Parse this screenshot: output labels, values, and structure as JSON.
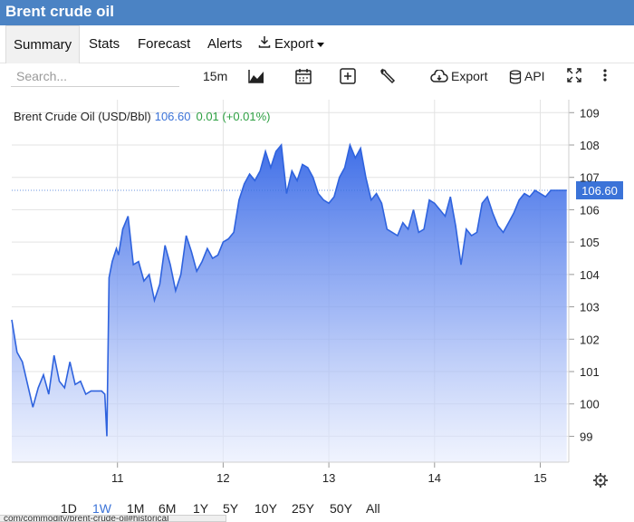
{
  "header": {
    "title": "Brent crude oil"
  },
  "tabs": [
    {
      "label": "Summary"
    },
    {
      "label": "Stats"
    },
    {
      "label": "Forecast"
    },
    {
      "label": "Alerts"
    },
    {
      "label": "Export"
    }
  ],
  "toolbar": {
    "search_placeholder": "Search...",
    "interval": "15m",
    "export_label": "Export",
    "api_label": "API"
  },
  "quote": {
    "name": "Brent Crude Oil (USD/Bbl)",
    "price": "106.60",
    "change": "0.01 (+0.01%)",
    "price_color": "#3b73d8",
    "change_color": "#2ea043"
  },
  "ranges": [
    "1D",
    "1W",
    "1M",
    "6M",
    "1Y",
    "5Y",
    "10Y",
    "25Y",
    "50Y",
    "All"
  ],
  "active_range": "1W",
  "status_url": "com/commodity/brent-crude-oil#historical",
  "colors": {
    "accent": "#3b73d8",
    "header": "#4b83c4"
  },
  "chart_data": {
    "type": "area",
    "title": "",
    "xlabel": "",
    "ylabel": "",
    "x_ticks": [
      "11",
      "12",
      "13",
      "14",
      "15"
    ],
    "ylim": [
      98.2,
      109.4
    ],
    "y_ticks": [
      99,
      100,
      101,
      102,
      103,
      104,
      105,
      106,
      107,
      108,
      109
    ],
    "last_value": 106.6,
    "last_value_label": "106.60",
    "grid": true,
    "series": [
      {
        "x": [
          10.0,
          10.05,
          10.1,
          10.15,
          10.2,
          10.25,
          10.3,
          10.35,
          10.4,
          10.45,
          10.5,
          10.55,
          10.6,
          10.65,
          10.7,
          10.75,
          10.8,
          10.85,
          10.88,
          10.9,
          10.92,
          10.95,
          10.99,
          11.01,
          11.05,
          11.1,
          11.15,
          11.2,
          11.25,
          11.3,
          11.35,
          11.4,
          11.45,
          11.5,
          11.55,
          11.6,
          11.65,
          11.7,
          11.75,
          11.8,
          11.85,
          11.9,
          11.95,
          12.0,
          12.05,
          12.1,
          12.15,
          12.2,
          12.25,
          12.3,
          12.35,
          12.4,
          12.45,
          12.5,
          12.55,
          12.6,
          12.65,
          12.7,
          12.75,
          12.8,
          12.85,
          12.9,
          12.95,
          13.0,
          13.05,
          13.1,
          13.15,
          13.2,
          13.25,
          13.3,
          13.35,
          13.4,
          13.45,
          13.5,
          13.55,
          13.6,
          13.65,
          13.7,
          13.75,
          13.8,
          13.85,
          13.9,
          13.95,
          14.0,
          14.05,
          14.1,
          14.15,
          14.2,
          14.25,
          14.3,
          14.35,
          14.4,
          14.45,
          14.5,
          14.55,
          14.6,
          14.65,
          14.7,
          14.75,
          14.8,
          14.85,
          14.9,
          14.95,
          15.0,
          15.05,
          15.1,
          15.15,
          15.2,
          15.25
        ],
        "values": [
          102.6,
          101.6,
          101.3,
          100.6,
          99.9,
          100.5,
          100.9,
          100.3,
          101.5,
          100.7,
          100.5,
          101.3,
          100.6,
          100.7,
          100.3,
          100.4,
          100.4,
          100.4,
          100.3,
          99.0,
          103.9,
          104.4,
          104.8,
          104.6,
          105.4,
          105.8,
          104.3,
          104.4,
          103.8,
          104.0,
          103.2,
          103.7,
          104.9,
          104.3,
          103.5,
          104.0,
          105.2,
          104.7,
          104.1,
          104.4,
          104.8,
          104.5,
          104.6,
          105.0,
          105.1,
          105.3,
          106.3,
          106.8,
          107.1,
          106.9,
          107.2,
          107.8,
          107.3,
          107.8,
          108.0,
          106.5,
          107.2,
          106.9,
          107.4,
          107.3,
          107.0,
          106.5,
          106.3,
          106.2,
          106.4,
          107.0,
          107.3,
          108.0,
          107.6,
          107.9,
          107.0,
          106.3,
          106.5,
          106.2,
          105.4,
          105.3,
          105.2,
          105.6,
          105.4,
          106.0,
          105.3,
          105.4,
          106.3,
          106.2,
          106.0,
          105.8,
          106.4,
          105.5,
          104.3,
          105.4,
          105.2,
          105.3,
          106.2,
          106.4,
          105.9,
          105.5,
          105.3,
          105.6,
          105.9,
          106.3,
          106.5,
          106.4,
          106.6,
          106.5,
          106.4,
          106.6,
          106.6,
          106.6,
          106.6
        ]
      }
    ]
  }
}
